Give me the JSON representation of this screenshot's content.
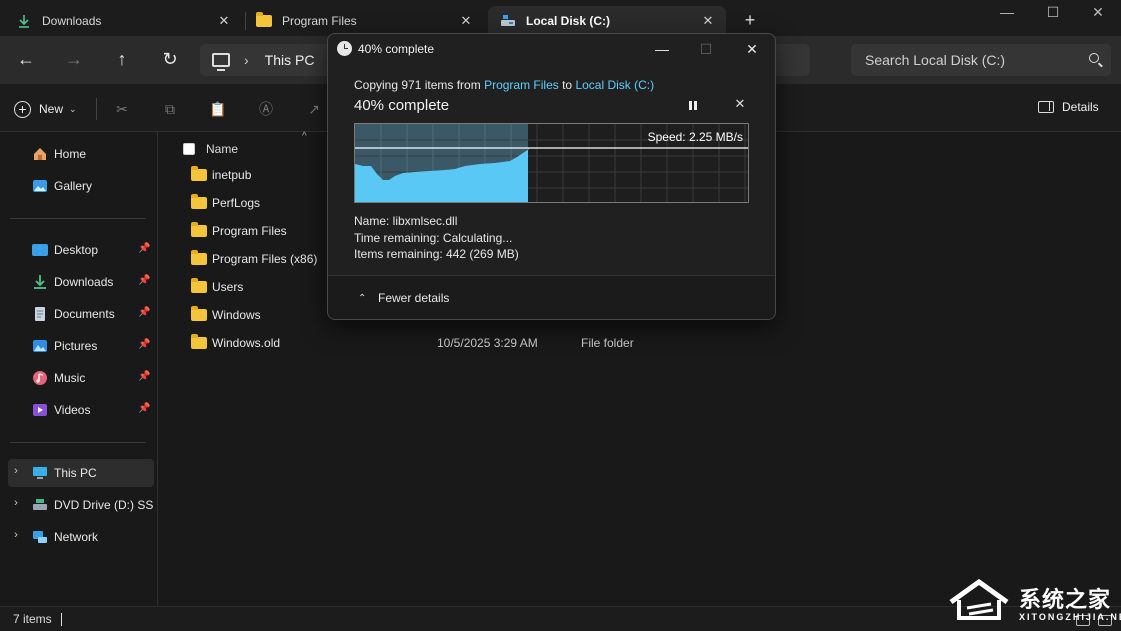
{
  "tabs": [
    {
      "label": "Downloads",
      "icon": "download-icon",
      "active": false
    },
    {
      "label": "Program Files",
      "icon": "folder-icon",
      "active": false
    },
    {
      "label": "Local Disk (C:)",
      "icon": "drive-icon",
      "active": true
    }
  ],
  "address": {
    "breadcrumb_root": "This PC",
    "search_placeholder": "Search Local Disk (C:)"
  },
  "commands": {
    "new_label": "New",
    "details_label": "Details"
  },
  "sidebar": {
    "items": [
      {
        "label": "Home",
        "icon": "home-icon",
        "pinned": false
      },
      {
        "label": "Gallery",
        "icon": "gallery-icon",
        "pinned": false
      },
      {
        "label": "Desktop",
        "icon": "desktop-icon",
        "pinned": true
      },
      {
        "label": "Downloads",
        "icon": "download-icon",
        "pinned": true
      },
      {
        "label": "Documents",
        "icon": "documents-icon",
        "pinned": true
      },
      {
        "label": "Pictures",
        "icon": "pictures-icon",
        "pinned": true
      },
      {
        "label": "Music",
        "icon": "music-icon",
        "pinned": true
      },
      {
        "label": "Videos",
        "icon": "videos-icon",
        "pinned": true
      },
      {
        "label": "This PC",
        "icon": "this-pc-icon",
        "selected": true
      },
      {
        "label": "DVD Drive (D:) SSS_",
        "icon": "dvd-drive-icon"
      },
      {
        "label": "Network",
        "icon": "network-icon"
      }
    ]
  },
  "filelist": {
    "header_name": "Name",
    "rows": [
      {
        "name": "inetpub",
        "date": "",
        "type": ""
      },
      {
        "name": "PerfLogs",
        "date": "",
        "type": ""
      },
      {
        "name": "Program Files",
        "date": "",
        "type": ""
      },
      {
        "name": "Program Files (x86)",
        "date": "",
        "type": ""
      },
      {
        "name": "Users",
        "date": "",
        "type": ""
      },
      {
        "name": "Windows",
        "date": "",
        "type": ""
      },
      {
        "name": "Windows.old",
        "date": "10/5/2025 3:29 AM",
        "type": "File folder"
      }
    ]
  },
  "status": {
    "item_count": "7 items"
  },
  "dialog": {
    "title": "40% complete",
    "copying_prefix": "Copying 971 items from ",
    "source": "Program Files",
    "to_word": " to ",
    "destination": "Local Disk (C:)",
    "percent_label": "40% complete",
    "progress_fraction": 0.44,
    "speed": "Speed: 2.25 MB/s",
    "name_line": "Name:  libxmlsec.dll",
    "time_line": "Time remaining:  Calculating...",
    "items_line": "Items remaining:  442 (269 MB)",
    "fewer_details": "Fewer details",
    "accent_color": "#60cdff"
  },
  "watermark": {
    "cn_text": "系统之家",
    "en_text": "XITONGZHIJIA.NET"
  }
}
